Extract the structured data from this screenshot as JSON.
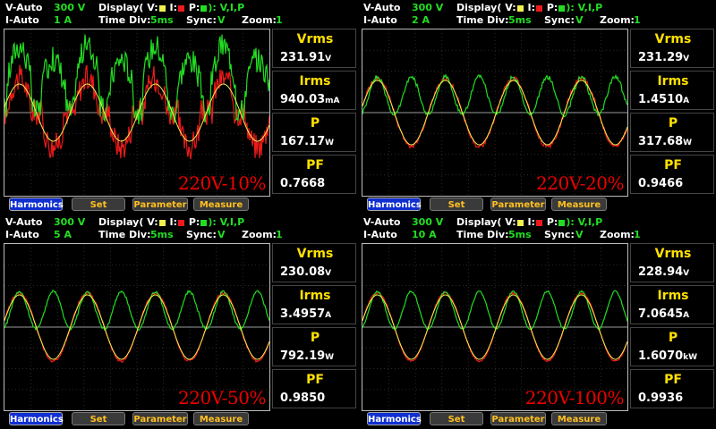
{
  "colors": {
    "voltage": "#f0f050",
    "current": "#ee1a1a",
    "power": "#22dd22"
  },
  "panels": [
    {
      "v_range": "300 V",
      "i_range": "1 A",
      "time_div": "5ms",
      "sync": "V",
      "zoom": "1",
      "tag": "220V-10%",
      "vrms": "231.91",
      "vrms_unit": "V",
      "irms": "940.03",
      "irms_unit": "mA",
      "p": "167.17",
      "p_unit": "W",
      "pf": "0.7668"
    },
    {
      "v_range": "300 V",
      "i_range": "2 A",
      "time_div": "5ms",
      "sync": "V",
      "zoom": "1",
      "tag": "220V-20%",
      "vrms": "231.29",
      "vrms_unit": "V",
      "irms": "1.4510",
      "irms_unit": "A",
      "p": "317.68",
      "p_unit": "W",
      "pf": "0.9466"
    },
    {
      "v_range": "300 V",
      "i_range": "5 A",
      "time_div": "5ms",
      "sync": "V",
      "zoom": "1",
      "tag": "220V-50%",
      "vrms": "230.08",
      "vrms_unit": "V",
      "irms": "3.4957",
      "irms_unit": "A",
      "p": "792.19",
      "p_unit": "W",
      "pf": "0.9850"
    },
    {
      "v_range": "300 V",
      "i_range": "10 A",
      "time_div": "5ms",
      "sync": "V",
      "zoom": "1",
      "tag": "220V-100%",
      "vrms": "228.94",
      "vrms_unit": "V",
      "irms": "7.0645",
      "irms_unit": "A",
      "p": "1.6070",
      "p_unit": "kW",
      "pf": "0.9936"
    }
  ],
  "labels": {
    "v_auto": "V-Auto",
    "i_auto": "I-Auto",
    "display": "Display(",
    "v": "V:",
    "i": "I:",
    "p": "P:",
    "display_sel": "):  V,I,P",
    "time_div": "Time Div:",
    "sync": "Sync:",
    "zoom": "Zoom:",
    "vrms": "Vrms",
    "irms": "Irms",
    "power": "P",
    "pf": "PF"
  },
  "buttons": {
    "harmonics": "Harmonics",
    "set": "Set",
    "parameter": "Parameter",
    "measure": "Measure"
  }
}
